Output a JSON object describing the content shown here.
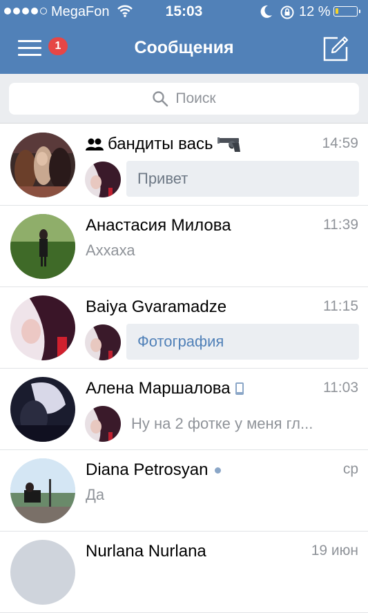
{
  "status": {
    "carrier": "MegaFon",
    "time": "15:03",
    "battery": "12 %",
    "battery_level": 0.12
  },
  "nav": {
    "title": "Сообщения",
    "badge": "1"
  },
  "search": {
    "placeholder": "Поиск"
  },
  "conversations": [
    {
      "name": "бандиты вась",
      "time": "14:59",
      "preview": "Привет",
      "is_group": true
    },
    {
      "name": "Анастасия Милова",
      "time": "11:39",
      "preview": "Аххаха"
    },
    {
      "name": "Baiya Gvaramadze",
      "time": "11:15",
      "preview": "Фотография"
    },
    {
      "name": "Алена Маршалова",
      "time": "11:03",
      "preview": "Ну на 2 фотке у меня гл..."
    },
    {
      "name": "Diana Petrosyan",
      "time": "ср",
      "preview": "Да"
    },
    {
      "name": "Nurlana Nurlana",
      "time": "19 июн"
    }
  ],
  "colors": {
    "header": "#5181b8",
    "badge": "#e64646",
    "bubble": "#ebeef2"
  }
}
